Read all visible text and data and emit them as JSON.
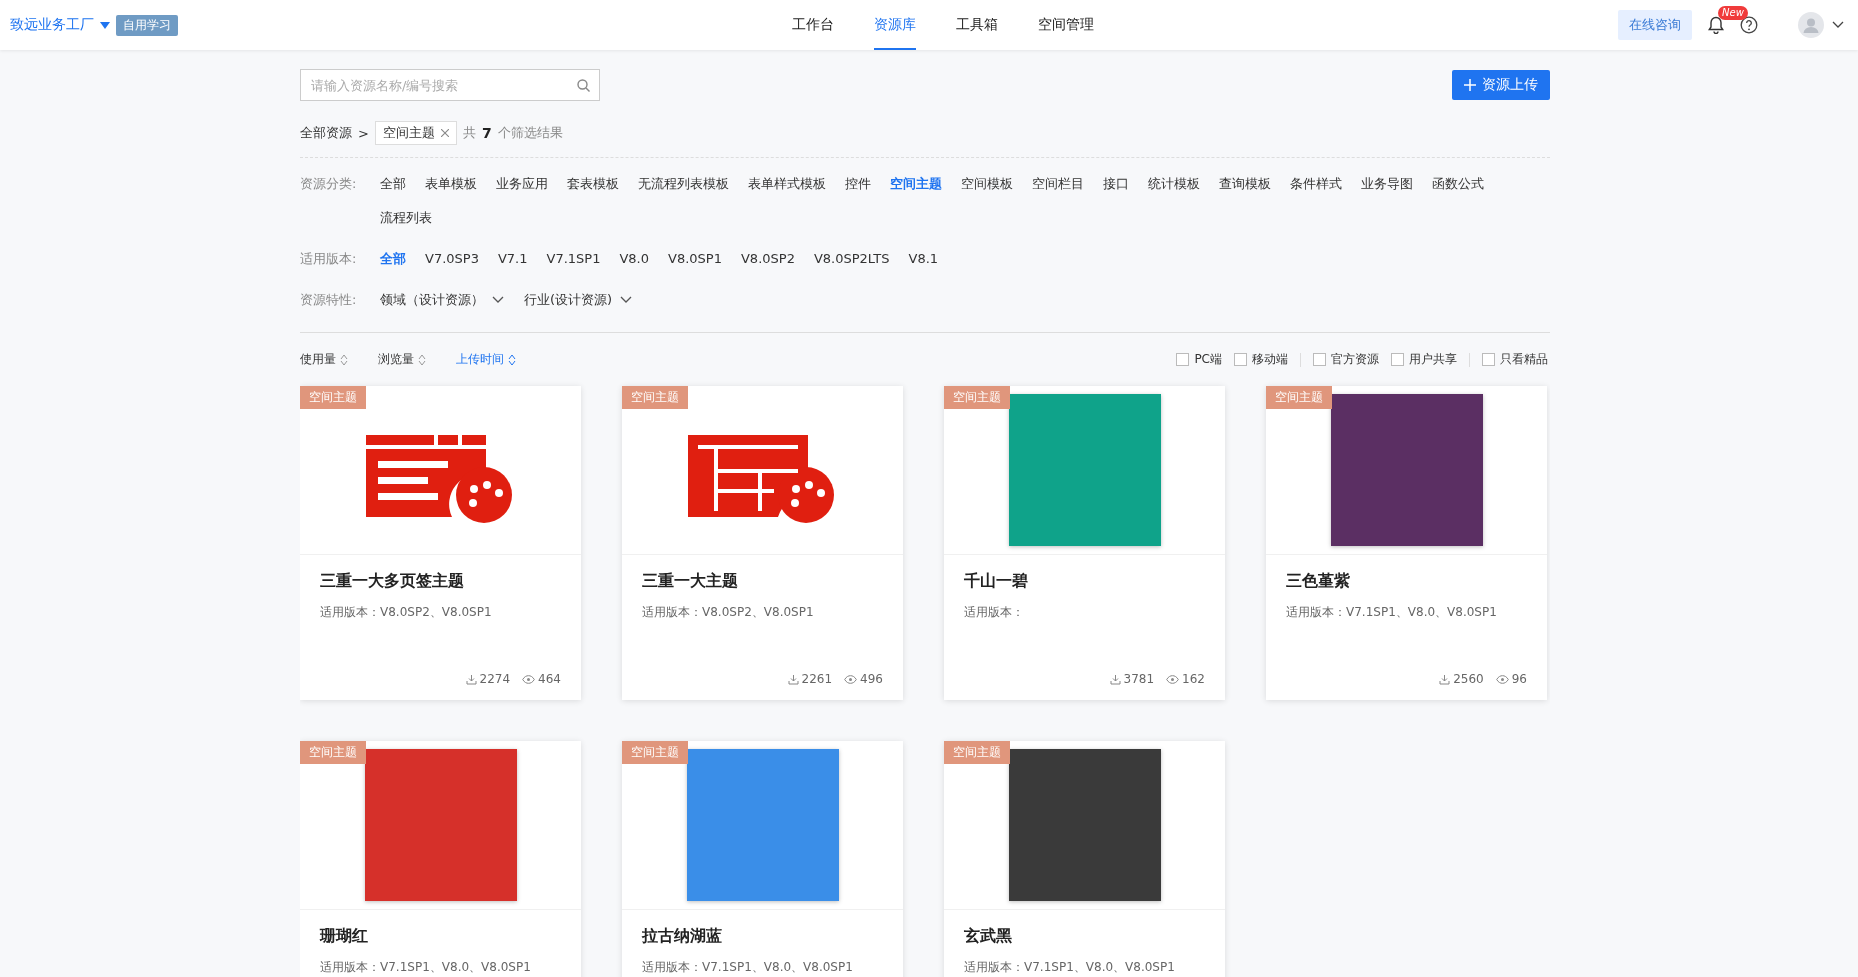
{
  "header": {
    "brand": "致远业务工厂",
    "badge": "自用学习",
    "nav": [
      {
        "label": "工作台",
        "selected": false
      },
      {
        "label": "资源库",
        "selected": true
      },
      {
        "label": "工具箱",
        "selected": false
      },
      {
        "label": "空间管理",
        "selected": false
      }
    ],
    "consult": "在线咨询",
    "new_badge": "New"
  },
  "search": {
    "placeholder": "请输入资源名称/编号搜索"
  },
  "upload": "资源上传",
  "breadcrumb": {
    "root": "全部资源",
    "sep": ">",
    "tag": "空间主题",
    "prefix": "共",
    "count": "7",
    "suffix": "个筛选结果"
  },
  "filters": [
    {
      "label": "资源分类:",
      "options": [
        {
          "label": "全部",
          "selected": false
        },
        {
          "label": "表单模板",
          "selected": false
        },
        {
          "label": "业务应用",
          "selected": false
        },
        {
          "label": "套表模板",
          "selected": false
        },
        {
          "label": "无流程列表模板",
          "selected": false
        },
        {
          "label": "表单样式模板",
          "selected": false
        },
        {
          "label": "控件",
          "selected": false
        },
        {
          "label": "空间主题",
          "selected": true
        },
        {
          "label": "空间模板",
          "selected": false
        },
        {
          "label": "空间栏目",
          "selected": false
        },
        {
          "label": "接口",
          "selected": false
        },
        {
          "label": "统计模板",
          "selected": false
        },
        {
          "label": "查询模板",
          "selected": false
        },
        {
          "label": "条件样式",
          "selected": false
        },
        {
          "label": "业务导图",
          "selected": false
        },
        {
          "label": "函数公式",
          "selected": false
        },
        {
          "label": "流程列表",
          "selected": false
        }
      ]
    },
    {
      "label": "适用版本:",
      "options": [
        {
          "label": "全部",
          "selected": true
        },
        {
          "label": "V7.0SP3",
          "selected": false
        },
        {
          "label": "V7.1",
          "selected": false
        },
        {
          "label": "V7.1SP1",
          "selected": false
        },
        {
          "label": "V8.0",
          "selected": false
        },
        {
          "label": "V8.0SP1",
          "selected": false
        },
        {
          "label": "V8.0SP2",
          "selected": false
        },
        {
          "label": "V8.0SP2LTS",
          "selected": false
        },
        {
          "label": "V8.1",
          "selected": false
        }
      ]
    }
  ],
  "features": {
    "label": "资源特性:",
    "dropdowns": [
      "领域（设计资源）",
      "行业(设计资源)"
    ]
  },
  "sorts": [
    {
      "label": "使用量",
      "selected": false
    },
    {
      "label": "浏览量",
      "selected": false
    },
    {
      "label": "上传时间",
      "selected": true
    }
  ],
  "checks": [
    {
      "label": "PC端",
      "checked": false
    },
    {
      "label": "移动端",
      "checked": false
    },
    {
      "label": "官方资源",
      "checked": false
    },
    {
      "label": "用户共享",
      "checked": false
    },
    {
      "label": "只看精品",
      "checked": false
    }
  ],
  "cards": [
    {
      "tag": "空间主题",
      "thumb": {
        "kind": "tabs-icon"
      },
      "title": "三重一大多页签主题",
      "versions": "适用版本：V8.0SP2、V8.0SP1",
      "downloads": "2274",
      "views": "464"
    },
    {
      "tag": "空间主题",
      "thumb": {
        "kind": "layout-icon"
      },
      "title": "三重一大主题",
      "versions": "适用版本：V8.0SP2、V8.0SP1",
      "downloads": "2261",
      "views": "496"
    },
    {
      "tag": "空间主题",
      "thumb": {
        "kind": "swatch",
        "color": "#0fa38a"
      },
      "title": "千山一碧",
      "versions": "适用版本：",
      "downloads": "3781",
      "views": "162"
    },
    {
      "tag": "空间主题",
      "thumb": {
        "kind": "swatch",
        "color": "#5b2f63"
      },
      "title": "三色堇紫",
      "versions": "适用版本：V7.1SP1、V8.0、V8.0SP1",
      "downloads": "2560",
      "views": "96"
    },
    {
      "tag": "空间主题",
      "thumb": {
        "kind": "swatch",
        "color": "#d6302a"
      },
      "title": "珊瑚红",
      "versions": "适用版本：V7.1SP1、V8.0、V8.0SP1"
    },
    {
      "tag": "空间主题",
      "thumb": {
        "kind": "swatch",
        "color": "#3a8ee8"
      },
      "title": "拉古纳湖蓝",
      "versions": "适用版本：V7.1SP1、V8.0、V8.0SP1"
    },
    {
      "tag": "空间主题",
      "thumb": {
        "kind": "swatch",
        "color": "#3a3a3a"
      },
      "title": "玄武黑",
      "versions": "适用版本：V7.1SP1、V8.0、V8.0SP1"
    }
  ]
}
